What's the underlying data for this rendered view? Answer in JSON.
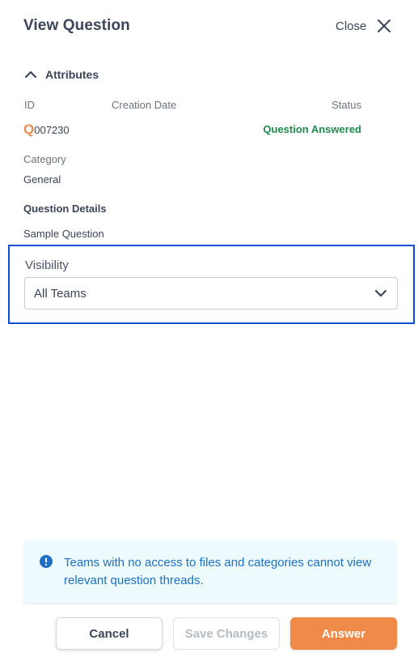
{
  "header": {
    "title": "View Question",
    "close_label": "Close"
  },
  "attributes": {
    "toggle_label": "Attributes",
    "id_label": "ID",
    "id_prefix": "Q",
    "id_number": "007230",
    "creation_date_label": "Creation Date",
    "creation_date_value": "",
    "status_label": "Status",
    "status_value": "Question Answered",
    "category_label": "Category",
    "category_value": "General"
  },
  "question_details": {
    "heading": "Question Details",
    "value": "Sample Question"
  },
  "visibility": {
    "label": "Visibility",
    "selected": "All Teams"
  },
  "notice": {
    "text": "Teams with no access to files and categories cannot view relevant question threads."
  },
  "actions": {
    "cancel": "Cancel",
    "save": "Save Changes",
    "answer": "Answer"
  },
  "colors": {
    "accent": "#ef8a48",
    "status_success": "#1f8a4c",
    "info_text": "#1e6fc2",
    "highlight_border": "#0a4fd6"
  }
}
